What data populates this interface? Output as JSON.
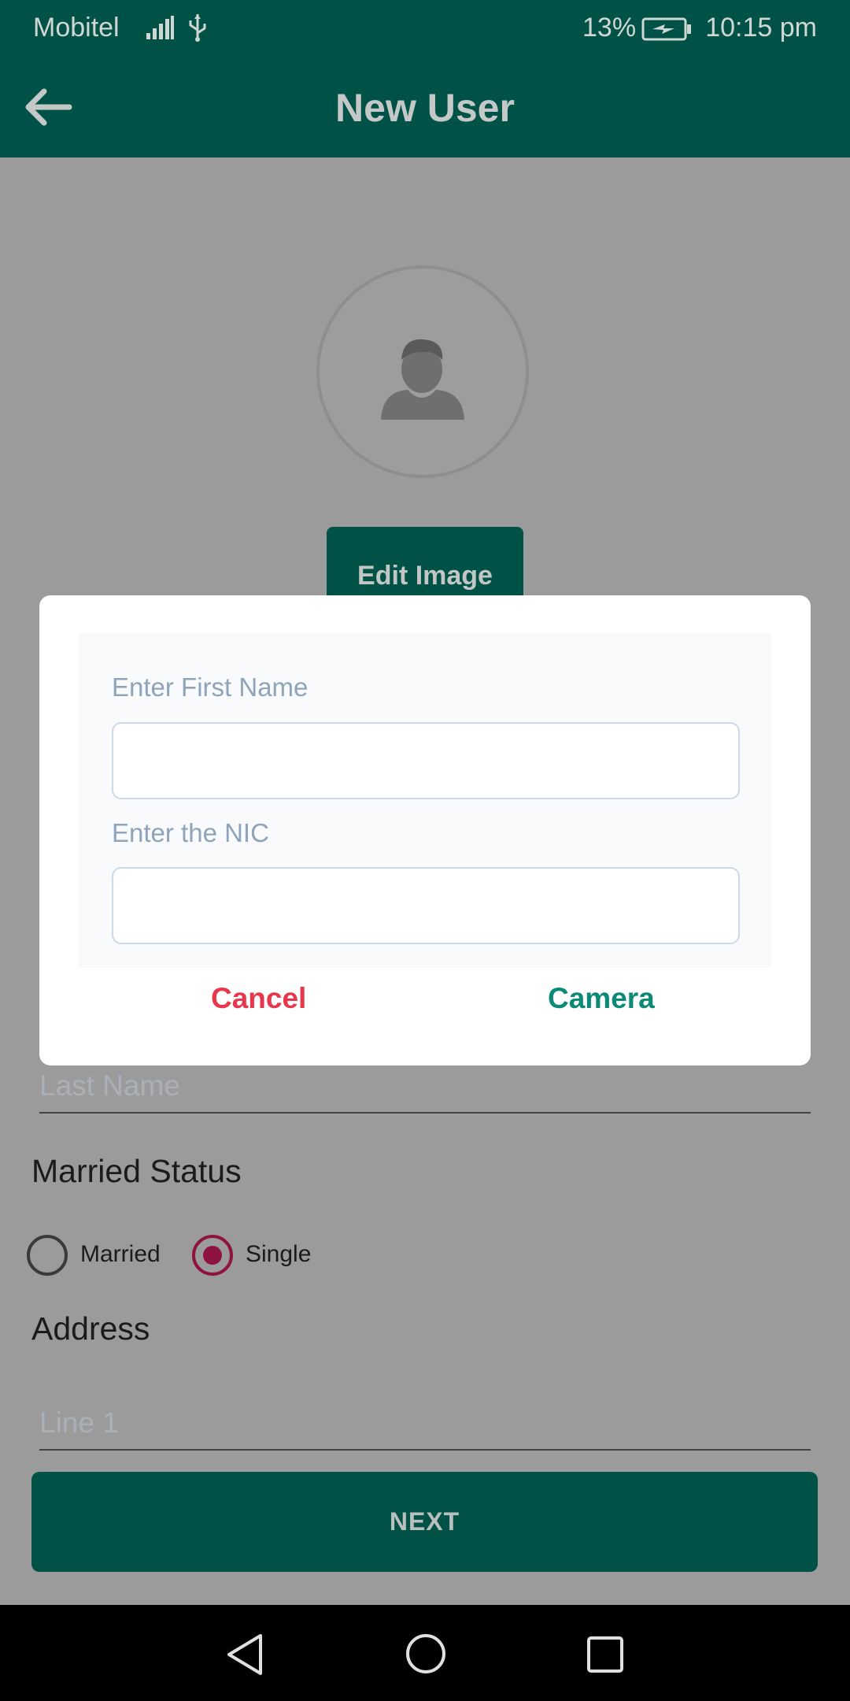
{
  "status_bar": {
    "carrier": "Mobitel",
    "battery_percent": "13%",
    "time": "10:15 pm",
    "icons": [
      "signal-icon",
      "usb-icon",
      "battery-charging-icon"
    ]
  },
  "app_bar": {
    "title": "New User",
    "back_icon": "arrow-left-icon"
  },
  "profile": {
    "avatar_icon": "person-placeholder-icon",
    "edit_image_label": "Edit Image"
  },
  "form": {
    "last_name_placeholder": "Last Name",
    "married_status_title": "Married Status",
    "married_options": [
      {
        "label": "Married",
        "selected": false
      },
      {
        "label": "Single",
        "selected": true
      }
    ],
    "address_title": "Address",
    "line1_placeholder": "Line 1",
    "next_label": "NEXT"
  },
  "dialog": {
    "first_name_label": "Enter First Name",
    "first_name_value": "",
    "nic_label": "Enter the NIC",
    "nic_value": "",
    "cancel_label": "Cancel",
    "camera_label": "Camera"
  },
  "nav_bar": {
    "icons": [
      "nav-back-icon",
      "nav-home-icon",
      "nav-recents-icon"
    ]
  },
  "colors": {
    "primary": "#005247",
    "accent_teal": "#0b8a78",
    "cancel_red": "#e6374d",
    "radio_selected": "#8f1340",
    "scrim": "#9b9b9b"
  }
}
